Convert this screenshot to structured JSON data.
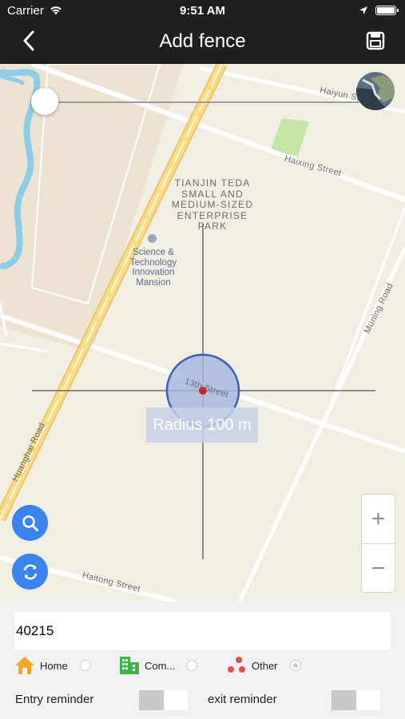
{
  "status_bar": {
    "carrier": "Carrier",
    "time": "9:51 AM"
  },
  "nav": {
    "title": "Add fence"
  },
  "map": {
    "labels": {
      "haiyun": "Haiyun St",
      "haixing": "Haixing Street",
      "park": "TIANJIN TEDA\nSMALL AND\nMEDIUM-SIZED\nENTERPRISE\nPARK",
      "mansion": "Science &\nTechnology\nInnovation\nMansion",
      "muning": "Muning Road",
      "street13": "13th Street",
      "huanghai": "Huanghai Road",
      "haitong": "Haitong Street"
    },
    "radius_label": "Radius 100 m",
    "radius_m": 100,
    "zoom_in": "+",
    "zoom_out": "−"
  },
  "form": {
    "fence_name": "40215",
    "options": [
      {
        "label": "Home",
        "icon": "home-icon",
        "color": "#f5a623",
        "selected": false
      },
      {
        "label": "Com...",
        "icon": "company-icon",
        "color": "#3cb54a",
        "selected": false
      },
      {
        "label": "Other",
        "icon": "other-icon",
        "color": "#e94b4b",
        "selected": true
      }
    ],
    "entry_reminder": "Entry reminder",
    "exit_reminder": "exit reminder",
    "entry_on": false,
    "exit_on": false
  },
  "colors": {
    "accent": "#3a84f0",
    "fence_stroke": "#3f5fbf",
    "center_dot": "#d0202a"
  }
}
